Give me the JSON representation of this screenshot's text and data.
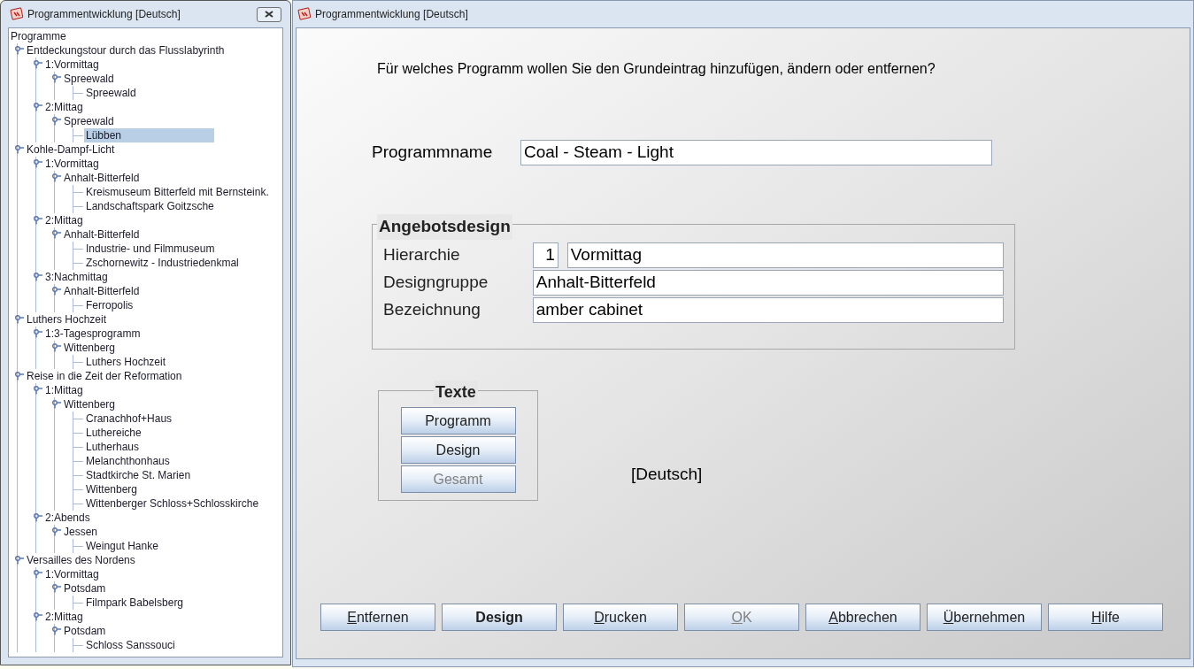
{
  "tree_window": {
    "title": "Programmentwicklung [Deutsch]",
    "tree": {
      "label": "Programme",
      "selected": false,
      "children": [
        {
          "label": "Entdeckungstour durch das Flusslabyrinth",
          "selected": false,
          "children": [
            {
              "label": "1:Vormittag",
              "selected": false,
              "children": [
                {
                  "label": "Spreewald",
                  "selected": false,
                  "children": [
                    {
                      "label": "Spreewald",
                      "selected": false
                    }
                  ]
                }
              ]
            },
            {
              "label": "2:Mittag",
              "selected": false,
              "children": [
                {
                  "label": "Spreewald",
                  "selected": false,
                  "children": [
                    {
                      "label": "Lübben",
                      "selected": true
                    }
                  ]
                }
              ]
            }
          ]
        },
        {
          "label": "Kohle-Dampf-Licht",
          "selected": false,
          "children": [
            {
              "label": "1:Vormittag",
              "selected": false,
              "children": [
                {
                  "label": "Anhalt-Bitterfeld",
                  "selected": false,
                  "children": [
                    {
                      "label": "Kreismuseum Bitterfeld mit Bernsteink.",
                      "selected": false
                    },
                    {
                      "label": "Landschaftspark Goitzsche",
                      "selected": false
                    }
                  ]
                }
              ]
            },
            {
              "label": "2:Mittag",
              "selected": false,
              "children": [
                {
                  "label": "Anhalt-Bitterfeld",
                  "selected": false,
                  "children": [
                    {
                      "label": "Industrie- und Filmmuseum",
                      "selected": false
                    },
                    {
                      "label": "Zschornewitz - Industriedenkmal",
                      "selected": false
                    }
                  ]
                }
              ]
            },
            {
              "label": "3:Nachmittag",
              "selected": false,
              "children": [
                {
                  "label": "Anhalt-Bitterfeld",
                  "selected": false,
                  "children": [
                    {
                      "label": "Ferropolis",
                      "selected": false
                    }
                  ]
                }
              ]
            }
          ]
        },
        {
          "label": "Luthers Hochzeit",
          "selected": false,
          "children": [
            {
              "label": "1:3-Tagesprogramm",
              "selected": false,
              "children": [
                {
                  "label": "Wittenberg",
                  "selected": false,
                  "children": [
                    {
                      "label": "Luthers Hochzeit",
                      "selected": false
                    }
                  ]
                }
              ]
            }
          ]
        },
        {
          "label": "Reise in die Zeit der Reformation",
          "selected": false,
          "children": [
            {
              "label": "1:Mittag",
              "selected": false,
              "children": [
                {
                  "label": "Wittenberg",
                  "selected": false,
                  "children": [
                    {
                      "label": "Cranachhof+Haus",
                      "selected": false
                    },
                    {
                      "label": "Luthereiche",
                      "selected": false
                    },
                    {
                      "label": "Lutherhaus",
                      "selected": false
                    },
                    {
                      "label": "Melanchthonhaus",
                      "selected": false
                    },
                    {
                      "label": "Stadtkirche St. Marien",
                      "selected": false
                    },
                    {
                      "label": "Wittenberg",
                      "selected": false
                    },
                    {
                      "label": "Wittenberger Schloss+Schlosskirche",
                      "selected": false
                    }
                  ]
                }
              ]
            },
            {
              "label": "2:Abends",
              "selected": false,
              "children": [
                {
                  "label": "Jessen",
                  "selected": false,
                  "children": [
                    {
                      "label": "Weingut Hanke",
                      "selected": false
                    }
                  ]
                }
              ]
            }
          ]
        },
        {
          "label": "Versailles des Nordens",
          "selected": false,
          "children": [
            {
              "label": "1:Vormittag",
              "selected": false,
              "children": [
                {
                  "label": "Potsdam",
                  "selected": false,
                  "children": [
                    {
                      "label": "Filmpark Babelsberg",
                      "selected": false
                    }
                  ]
                }
              ]
            },
            {
              "label": "2:Mittag",
              "selected": false,
              "children": [
                {
                  "label": "Potsdam",
                  "selected": false,
                  "children": [
                    {
                      "label": "Schloss Sanssouci",
                      "selected": false
                    }
                  ]
                }
              ]
            }
          ]
        }
      ]
    }
  },
  "main_window": {
    "title": "Programmentwicklung [Deutsch]",
    "question": "Für welches Programm wollen Sie den Grundeintrag hinzufügen, ändern oder entfernen?",
    "program_name": {
      "label": "Programmname",
      "value": "Coal - Steam - Light"
    },
    "offer_design": {
      "title": "Angebotsdesign",
      "hierarchy": {
        "label": "Hierarchie",
        "number": "1",
        "value": "Vormittag"
      },
      "design_group": {
        "label": "Designgruppe",
        "value": "Anhalt-Bitterfeld"
      },
      "designation": {
        "label": "Bezeichnung",
        "value": "amber cabinet"
      }
    },
    "texts": {
      "title": "Texte",
      "buttons": [
        {
          "label": "Programm",
          "disabled": false
        },
        {
          "label": "Design",
          "disabled": false
        },
        {
          "label": "Gesamt",
          "disabled": true
        }
      ]
    },
    "language": "[Deutsch]",
    "buttons": [
      {
        "label": "Entfernen",
        "mnemonic": true,
        "default": false,
        "disabled": false
      },
      {
        "label": "Design",
        "mnemonic": false,
        "default": true,
        "disabled": false
      },
      {
        "label": "Drucken",
        "mnemonic": true,
        "default": false,
        "disabled": false
      },
      {
        "label": "OK",
        "mnemonic": true,
        "default": false,
        "disabled": true
      },
      {
        "label": "Abbrechen",
        "mnemonic": true,
        "default": false,
        "disabled": false
      },
      {
        "label": "Übernehmen",
        "mnemonic": true,
        "default": false,
        "disabled": false
      },
      {
        "label": "Hilfe",
        "mnemonic": true,
        "default": false,
        "disabled": false
      }
    ]
  }
}
